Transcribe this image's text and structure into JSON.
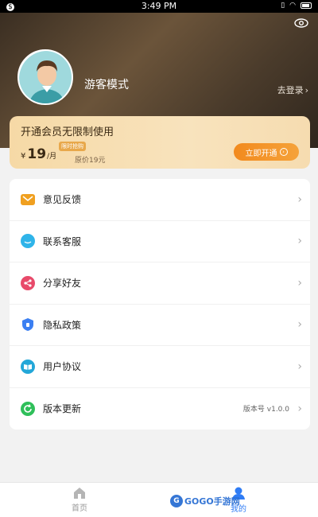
{
  "status_bar": {
    "time": "3:49 PM",
    "left_icon": "notification-dot-icon"
  },
  "header": {
    "username": "游客模式",
    "login_link": "去登录",
    "eye_icon": "eye-icon"
  },
  "vip": {
    "title": "开通会员无限制使用",
    "badge": "限时抢购",
    "currency": "¥",
    "price": "19",
    "unit": "/月",
    "original": "原价19元",
    "button": "立即开通"
  },
  "menu": {
    "items": [
      {
        "label": "意见反馈",
        "icon": "mail-icon",
        "color": "#f0a020"
      },
      {
        "label": "联系客服",
        "icon": "chat-icon",
        "color": "#2fb4e9"
      },
      {
        "label": "分享好友",
        "icon": "share-icon",
        "color": "#e84a6a"
      },
      {
        "label": "隐私政策",
        "icon": "shield-icon",
        "color": "#3b7ff2"
      },
      {
        "label": "用户协议",
        "icon": "book-icon",
        "color": "#23a7d8"
      },
      {
        "label": "版本更新",
        "icon": "refresh-icon",
        "color": "#2fbf5a",
        "extra": "版本号 v1.0.0"
      }
    ]
  },
  "bottom_nav": {
    "home": "首页",
    "mine": "我的",
    "active_color": "#2f7cf5"
  },
  "watermark": {
    "text": "GOGO手游网"
  }
}
